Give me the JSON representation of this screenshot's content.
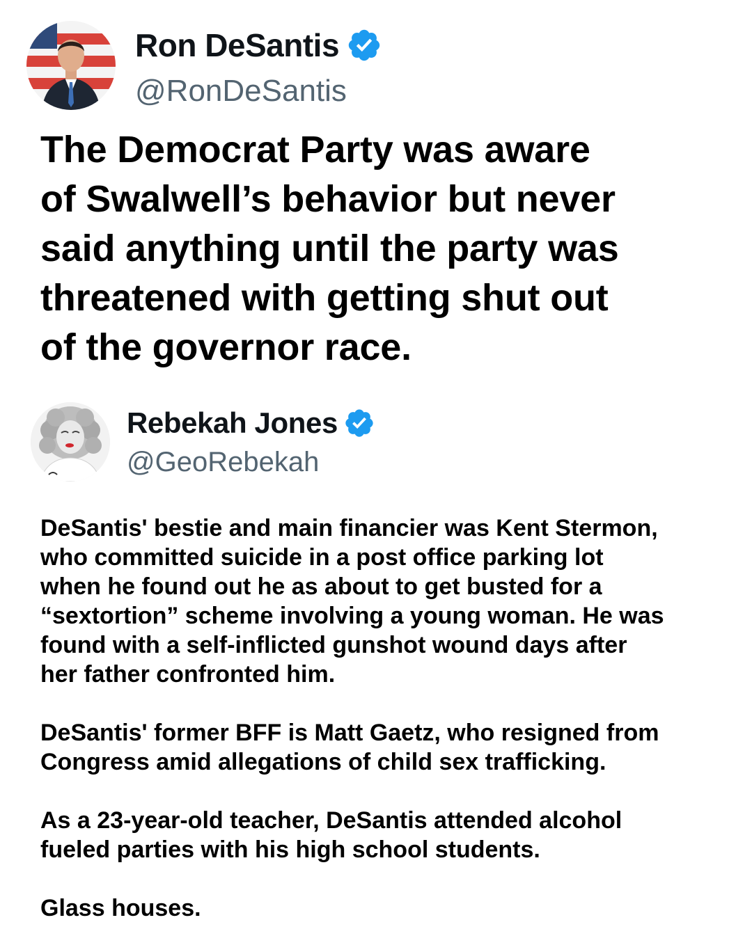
{
  "main_tweet": {
    "author": {
      "name": "Ron DeSantis",
      "handle": "@RonDeSantis",
      "verified": true
    },
    "text_lines": [
      "The Democrat Party was aware",
      "of Swalwell’s behavior but never",
      "said anything until the party was",
      "threatened with getting shut out",
      "of the governor race."
    ]
  },
  "quoted_tweet": {
    "author": {
      "name": "Rebekah Jones",
      "handle": "@GeoRebekah",
      "verified": true
    },
    "paragraphs": [
      {
        "lines": [
          "DeSantis' bestie and main financier was Kent Stermon,",
          "who committed suicide in a post office parking lot",
          "when he found out he as about to get busted for a",
          "“sextortion” scheme involving a young woman. He was",
          "found with a self-inflicted gunshot wound days after",
          "her father confronted him."
        ]
      },
      {
        "lines": [
          "DeSantis' former BFF is Matt Gaetz, who resigned from",
          "Congress amid allegations of child sex trafficking."
        ]
      },
      {
        "lines": [
          "As a 23-year-old teacher, DeSantis attended alcohol",
          "fueled parties with his high school students."
        ]
      },
      {
        "lines": [
          "Glass houses."
        ]
      }
    ]
  },
  "colors": {
    "verified_badge": "#1d9bf0",
    "handle": "#536471",
    "text": "#000000"
  },
  "icons": {
    "verified": "verified-badge-icon"
  }
}
